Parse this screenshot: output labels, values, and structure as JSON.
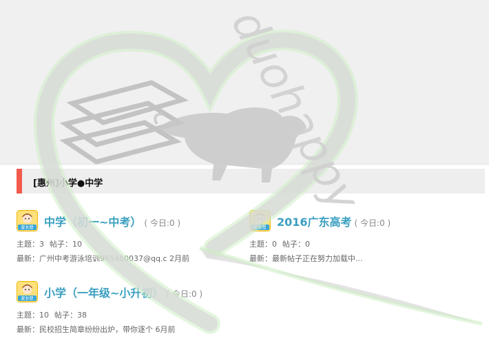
{
  "watermark_text": "duohappy",
  "section": {
    "title": "[惠州]小学●中学"
  },
  "forums": [
    {
      "title": "中学（初一~中考）",
      "today": "( 今日:0 )",
      "stats": {
        "topics_label": "主题：",
        "topics": "3",
        "posts_label": "帖子：",
        "posts": "10"
      },
      "latest": {
        "label": "最新：",
        "post": "广州中考游泳培训965460037@qq.c",
        "time": "2月前"
      },
      "avatar_text": "家长帮"
    },
    {
      "title": "2016广东高考",
      "today": "( 今日:0 )",
      "stats": {
        "topics_label": "主题：",
        "topics": "0",
        "posts_label": "帖子：",
        "posts": "0"
      },
      "latest": {
        "label": "最新：",
        "post": "最新帖子正在努力加载中...",
        "time": ""
      },
      "avatar_text": "家长帮"
    },
    {
      "title": "小学（一年级~小升初）",
      "today": "( 今日:0 )",
      "stats": {
        "topics_label": "主题：",
        "topics": "10",
        "posts_label": "帖子：",
        "posts": "38"
      },
      "latest": {
        "label": "最新：",
        "post": "民校招生简章纷纷出炉，带你逐个",
        "time": "6月前"
      },
      "avatar_text": "家长帮"
    }
  ],
  "colors": {
    "accent_bar": "#f25a4c",
    "title": "#3a9fc0",
    "meta": "#666666"
  },
  "icons": {
    "avatar": "mascot-avatar-icon"
  }
}
